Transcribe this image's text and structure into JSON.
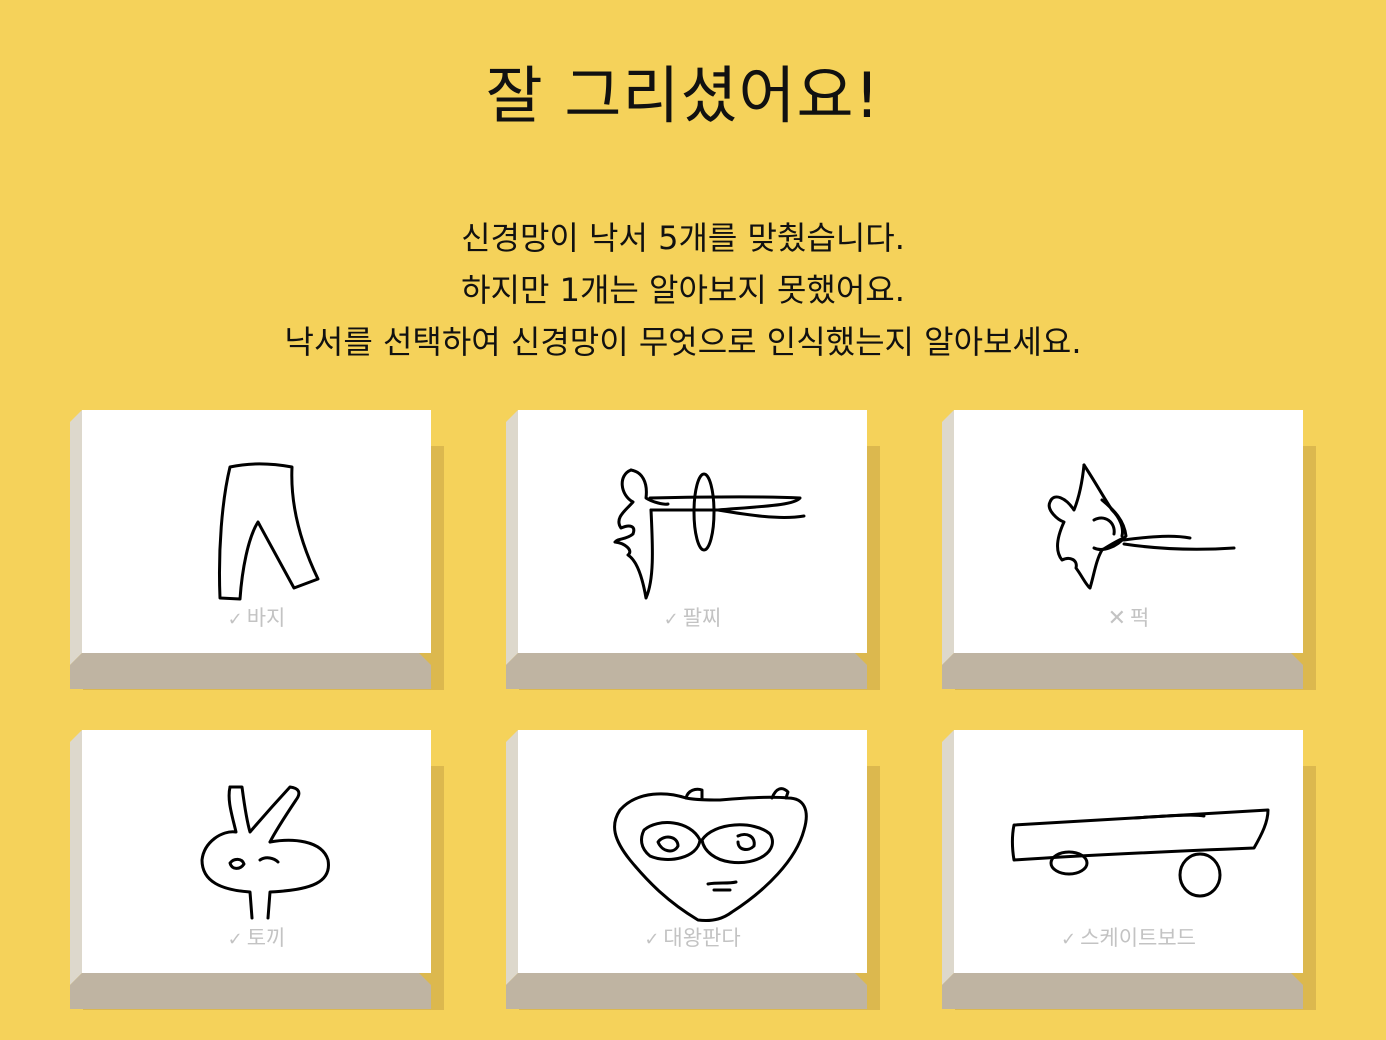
{
  "page": {
    "title": "잘 그리셨어요!",
    "summary_lines": [
      "신경망이 낙서 5개를 맞췄습니다.",
      "하지만 1개는 알아보지 못했어요.",
      "낙서를 선택하여 신경망이 무엇으로 인식했는지 알아보세요."
    ]
  },
  "doodles": [
    {
      "label": "바지",
      "mark": "✓",
      "recognized": true,
      "icon": "pants-doodle"
    },
    {
      "label": "팔찌",
      "mark": "✓",
      "recognized": true,
      "icon": "bracelet-doodle"
    },
    {
      "label": "퍽",
      "mark": "✕",
      "recognized": false,
      "icon": "hockey-puck-doodle"
    },
    {
      "label": "토끼",
      "mark": "✓",
      "recognized": true,
      "icon": "rabbit-doodle"
    },
    {
      "label": "대왕판다",
      "mark": "✓",
      "recognized": true,
      "icon": "giant-panda-doodle"
    },
    {
      "label": "스케이트보드",
      "mark": "✓",
      "recognized": true,
      "icon": "skateboard-doodle"
    }
  ],
  "colors": {
    "background": "#f5d25a",
    "card_face": "#ffffff",
    "label_text": "#c3c3c3"
  }
}
